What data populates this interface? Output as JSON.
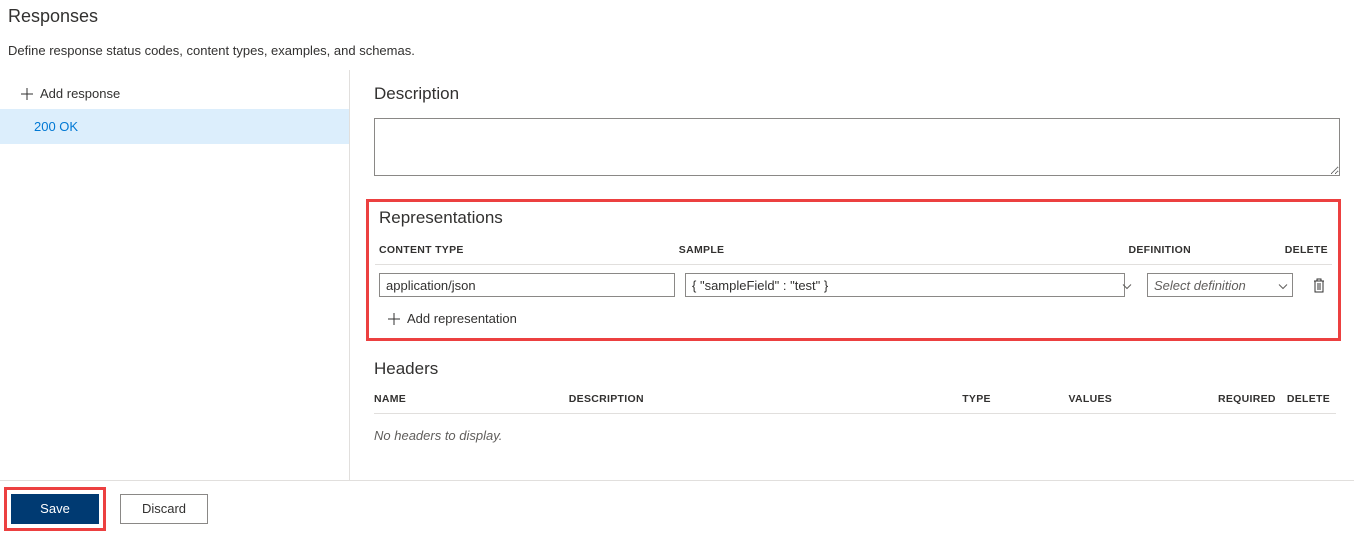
{
  "page": {
    "title": "Responses",
    "subtitle": "Define response status codes, content types, examples, and schemas."
  },
  "sidebar": {
    "add_response_label": "Add response",
    "items": [
      {
        "label": "200 OK",
        "active": true
      }
    ]
  },
  "description": {
    "heading": "Description",
    "value": ""
  },
  "representations": {
    "heading": "Representations",
    "columns": {
      "content_type": "CONTENT TYPE",
      "sample": "SAMPLE",
      "definition": "DEFINITION",
      "delete": "DELETE"
    },
    "rows": [
      {
        "content_type": "application/json",
        "sample": "{ \"sampleField\" : \"test\" }",
        "definition_placeholder": "Select definition"
      }
    ],
    "add_label": "Add representation"
  },
  "headers": {
    "heading": "Headers",
    "columns": {
      "name": "NAME",
      "description": "DESCRIPTION",
      "type": "TYPE",
      "values": "VALUES",
      "required": "REQUIRED",
      "delete": "DELETE"
    },
    "empty_text": "No headers to display."
  },
  "footer": {
    "save_label": "Save",
    "discard_label": "Discard"
  }
}
